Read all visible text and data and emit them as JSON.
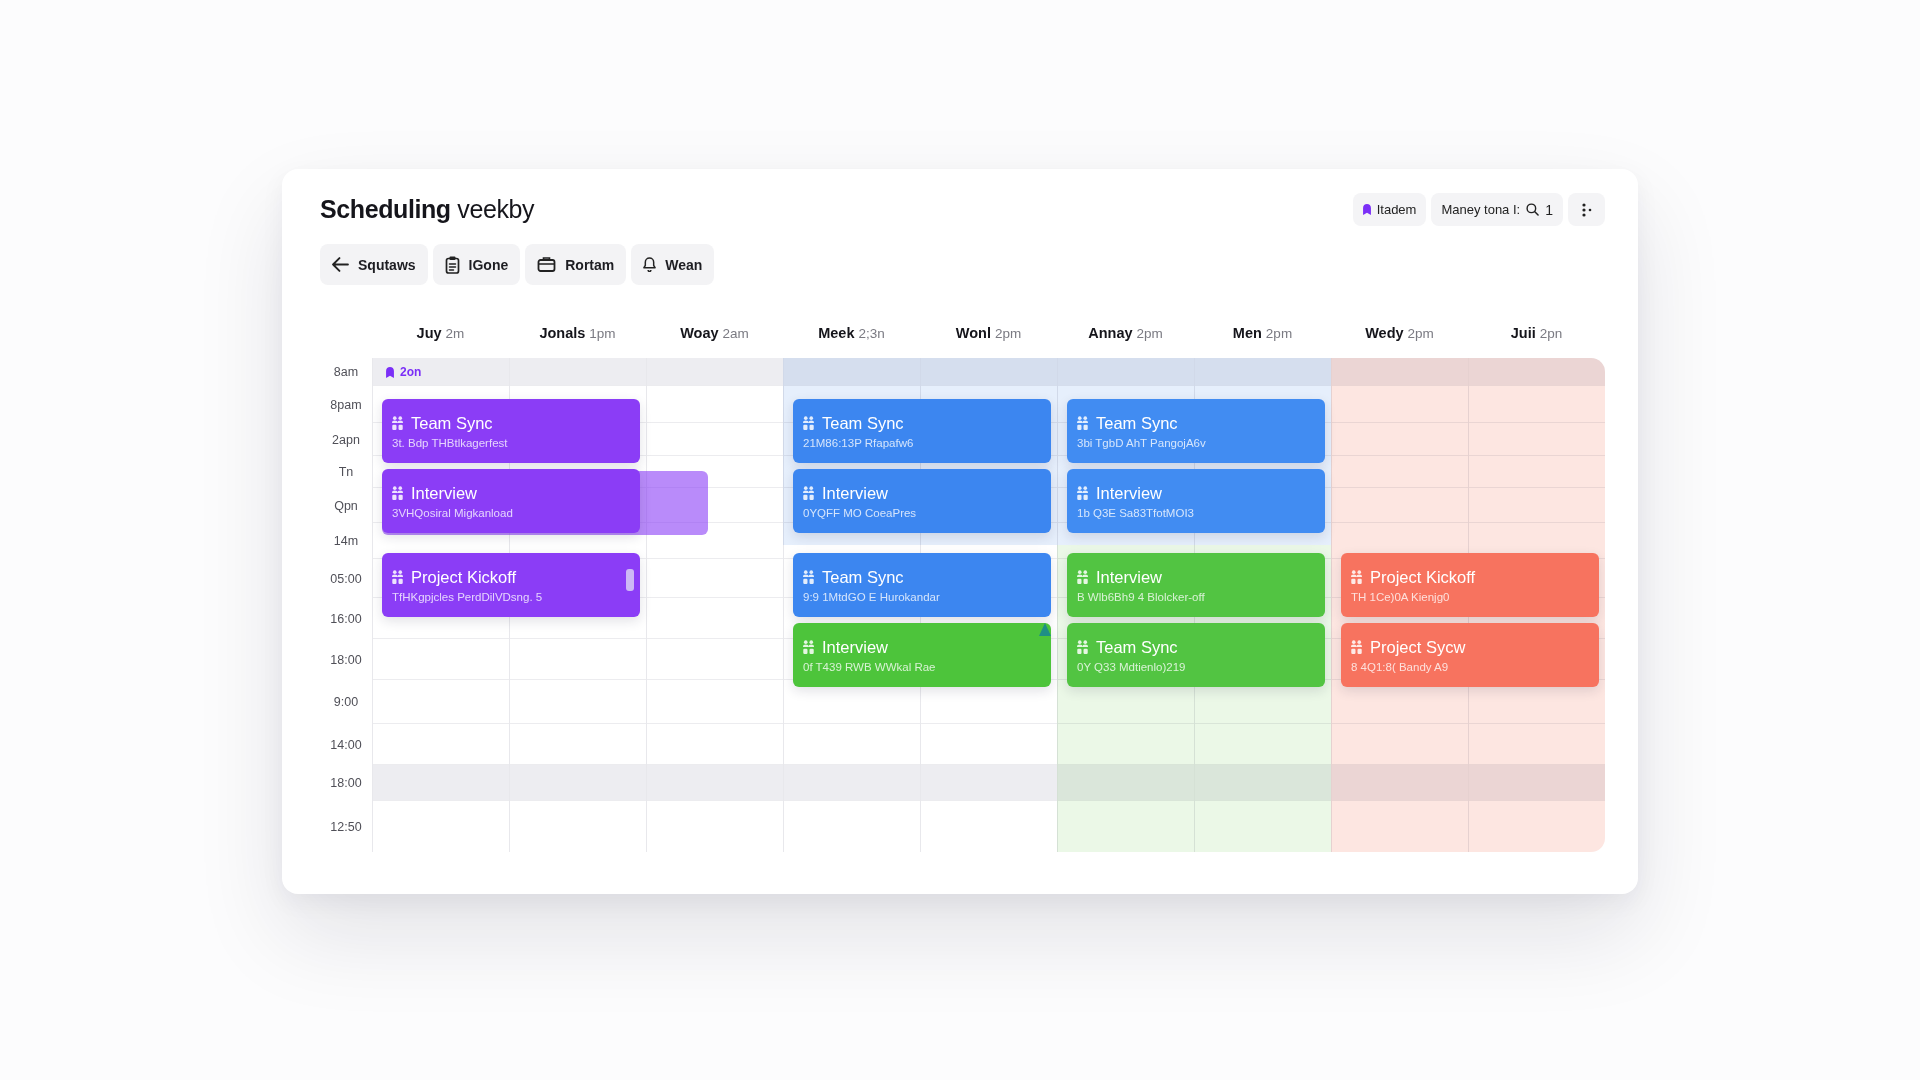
{
  "header": {
    "title": "**Scheduling** veekby",
    "user_chip": "Itadem",
    "filter": {
      "label": "Maney tona I:",
      "count": "1"
    }
  },
  "toolbar": [
    {
      "label": "Squtaws"
    },
    {
      "label": "IGone"
    },
    {
      "label": "Rortam"
    },
    {
      "label": "Wean"
    }
  ],
  "days": [
    {
      "name": "Juy",
      "time": "2m",
      "blocks": [
        {
          "events": [
            {
              "kind": "plain",
              "title": "Team Sync",
              "subtitle": "3t. Bdp THBtlkagerfest",
              "color": "#8b3df6"
            },
            {
              "kind": "extended",
              "title": "Interview",
              "subtitle": "3VHQosiral Migkanload",
              "color": "#8b3df6"
            }
          ]
        },
        {
          "events": [
            {
              "kind": "handle",
              "title": "Project Kickoff",
              "subtitle": "TfHKgpjcles PerdDilVDsng. 5",
              "color": "#8b3df6"
            }
          ]
        }
      ]
    },
    {
      "name": "Jonals",
      "time": "1pm"
    },
    {
      "name": "Woay",
      "time": "2am"
    },
    {
      "name": "Meek",
      "time": "2;3n",
      "blocks": [
        {
          "color": "#e6effc",
          "events": [
            {
              "kind": "plain",
              "title": "Team Sync",
              "subtitle": "21M86:13P Rfapafw6",
              "color": "#3c86f0"
            },
            {
              "kind": "plain",
              "title": "Interview",
              "subtitle": "0YQFF MO CoeaPres",
              "color": "#3c86f0"
            }
          ]
        },
        {
          "events": [
            {
              "kind": "plain",
              "title": "Team Sync",
              "subtitle": "9:9 1MtdGO E Hurokandar",
              "color": "#3c86f0"
            },
            {
              "kind": "flagged",
              "title": "Interview",
              "subtitle": "0f T439 RWB WWkal Rae",
              "color": "#4dc43b"
            }
          ]
        }
      ]
    },
    {
      "name": "Wonl",
      "time": "2pm"
    },
    {
      "name": "Annay",
      "time": "2pm",
      "blocks": [
        {
          "color": "#e6effc",
          "events": [
            {
              "kind": "plain",
              "title": "Team Sync",
              "subtitle": "3bi TgbD AhT PangojA6v",
              "color": "#418cf2"
            },
            {
              "kind": "plain",
              "title": "Interview",
              "subtitle": "1b Q3E Sa83TfotMOI3",
              "color": "#418cf2"
            }
          ]
        },
        {
          "color": "#ebf8e7",
          "events": [
            {
              "kind": "plain",
              "title": "Interview",
              "subtitle": "B Wlb6Bh9 4 Blolcker-off",
              "color": "#52c442"
            },
            {
              "kind": "plain",
              "title": "Team Sync",
              "subtitle": "0Y Q33 Mdtienlo)219",
              "color": "#52c442"
            }
          ]
        }
      ]
    },
    {
      "name": "Men",
      "time": "2pm"
    },
    {
      "name": "Wedy",
      "time": "2pm",
      "blocks": [
        {
          "color": "#fde6e1"
        },
        {
          "color": "#fde6e1",
          "events": [
            {
              "kind": "plain",
              "title": "Project Kickoff",
              "subtitle": "TH 1Ce)0A Kienjg0",
              "color": "#f7735f"
            },
            {
              "kind": "plain",
              "title": "Project Sycw",
              "subtitle": "8 4Q1:8( Bandy A9",
              "color": "#f7735f"
            }
          ]
        }
      ]
    },
    {
      "name": "Juii",
      "time": "2pn"
    }
  ],
  "all_day": {
    "label": "2on"
  },
  "times": [
    {
      "label": "8am",
      "shaded": true
    },
    {
      "label": "8pam",
      "shaded": false
    },
    {
      "label": "2apn",
      "shaded": false
    },
    {
      "label": "Tn",
      "shaded": false
    },
    {
      "label": "Qpn",
      "shaded": false
    },
    {
      "label": "14m",
      "shaded": false
    },
    {
      "label": "05:00",
      "shaded": false
    },
    {
      "label": "16:00",
      "shaded": false
    },
    {
      "label": "18:00",
      "shaded": false
    },
    {
      "label": "9:00",
      "shaded": false
    },
    {
      "label": "14:00",
      "shaded": false
    },
    {
      "label": "18:00",
      "shaded": true
    },
    {
      "label": "12:50",
      "shaded": false
    }
  ]
}
